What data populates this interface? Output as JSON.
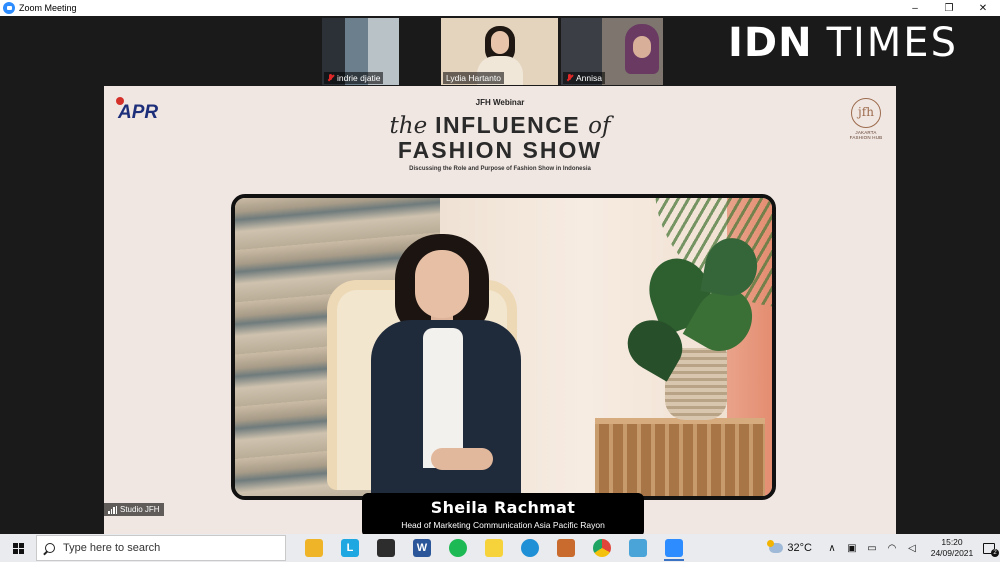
{
  "window": {
    "title": "Zoom Meeting",
    "controls": [
      "–",
      "❐",
      "✕"
    ]
  },
  "participants": [
    {
      "name": "indrie djatie",
      "muted": true,
      "bg": "#3c4a55"
    },
    {
      "name": "Lydia Hartanto",
      "muted": false,
      "bg": "#d9c4a9"
    },
    {
      "name": "Annisa",
      "muted": true,
      "bg": "#5a5f66"
    }
  ],
  "watermark": {
    "part1": "IDN",
    "part2": "TIMES"
  },
  "slide": {
    "logo_left": "APR",
    "logo_right": "jfh",
    "logo_right_sub": "JAKARTA FASHION HUB",
    "kicker": "JFH Webinar",
    "title_italic_1": "the",
    "title_word_1": "INFLUENCE",
    "title_italic_2": "of",
    "title_line_2": "FASHION SHOW",
    "tagline": "Discussing the Role and Purpose of Fashion Show in Indonesia"
  },
  "speaker": {
    "name": "Sheila Rachmat",
    "role": "Head of Marketing Communication Asia Pacific Rayon"
  },
  "active_speaker_tag": "Studio JFH",
  "taskbar": {
    "search_placeholder": "Type here to search",
    "apps": [
      {
        "id": "file-explorer",
        "glyph": "",
        "color": "#f0b429"
      },
      {
        "id": "app-l",
        "glyph": "L",
        "color": "#1ea7e0"
      },
      {
        "id": "store",
        "glyph": "",
        "color": "#2d2d2d"
      },
      {
        "id": "word",
        "glyph": "W",
        "color": "#2b579a"
      },
      {
        "id": "spotify",
        "glyph": "",
        "color": "#1db954"
      },
      {
        "id": "sticky-notes",
        "glyph": "",
        "color": "#f7d33b"
      },
      {
        "id": "edge",
        "glyph": "",
        "color": "#1f8fd6"
      },
      {
        "id": "paint",
        "glyph": "",
        "color": "#c96b2f"
      },
      {
        "id": "chrome",
        "glyph": "",
        "color": "#e1463a"
      },
      {
        "id": "notes",
        "glyph": "",
        "color": "#4aa4d8"
      },
      {
        "id": "zoom",
        "glyph": "",
        "color": "#2d8cff"
      }
    ],
    "weather": "32°C",
    "time": "15:20",
    "date": "24/09/2021",
    "notification_count": "2"
  }
}
